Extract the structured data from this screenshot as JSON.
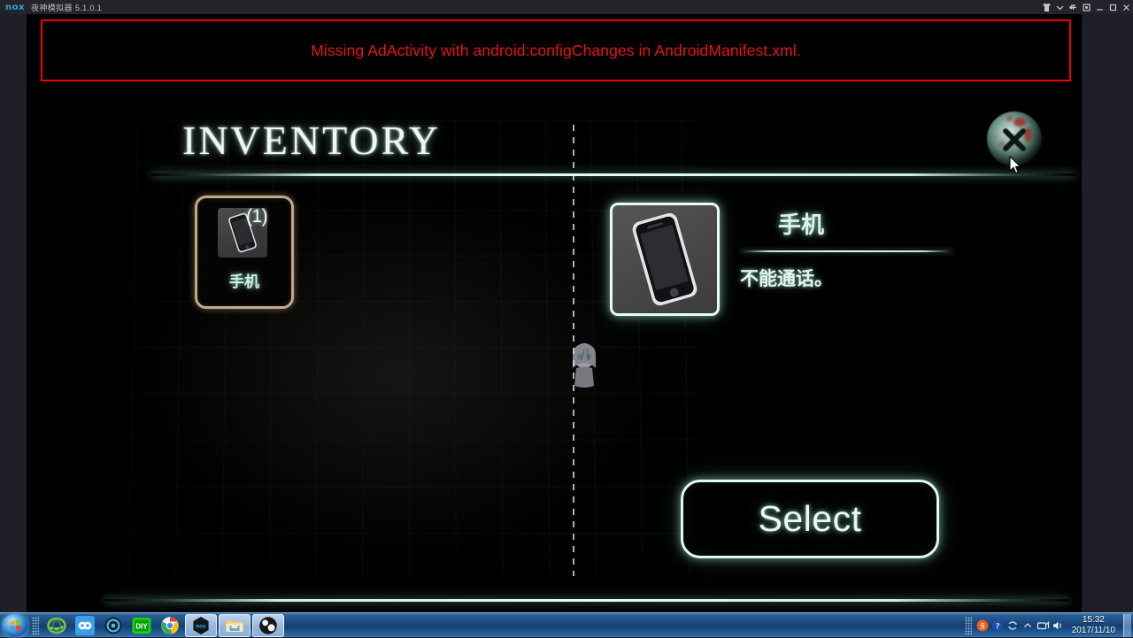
{
  "window": {
    "logo": "nox",
    "title": "夜神模拟器 5.1.0.1",
    "controls": [
      {
        "name": "shirt-icon",
        "label": "T"
      },
      {
        "name": "chevron-down-icon",
        "label": "v"
      },
      {
        "name": "pin-icon",
        "label": "P"
      },
      {
        "name": "gear-icon",
        "label": "G"
      },
      {
        "name": "minimize-button",
        "label": "—"
      },
      {
        "name": "maximize-button",
        "label": "❐"
      },
      {
        "name": "close-button",
        "label": "✕"
      }
    ]
  },
  "ad_error": {
    "message": "Missing AdActivity with android:configChanges in AndroidManifest.xml.",
    "border_color": "#ee0000",
    "text_color": "#e61616"
  },
  "game": {
    "title": "INVENTORY",
    "close_button_label": "X",
    "accent_color": "#dffaf1",
    "slot_border_color": "#c3a887",
    "slots": [
      {
        "label": "手机",
        "count": "(1)",
        "icon": "phone-icon"
      }
    ],
    "detail": {
      "name": "手机",
      "description": "不能通话。",
      "icon": "phone-icon"
    },
    "select_button": "Select"
  },
  "taskbar": {
    "start": "start-orb",
    "items": [
      {
        "name": "taskbar-icon-internet-explorer",
        "label": "e"
      },
      {
        "name": "taskbar-icon-baidu-cloud",
        "label": "cloud"
      },
      {
        "name": "taskbar-icon-media-player",
        "label": "circle"
      },
      {
        "name": "taskbar-icon-diy",
        "label": "DIY"
      },
      {
        "name": "taskbar-icon-chrome",
        "label": "chrome"
      }
    ],
    "buttons": [
      {
        "name": "taskbar-button-nox",
        "label": "nox"
      },
      {
        "name": "taskbar-button-explorer",
        "label": "folder"
      },
      {
        "name": "taskbar-button-obs",
        "label": "obs"
      }
    ],
    "tray": [
      {
        "name": "tray-icon-sogou-input",
        "label": "S"
      },
      {
        "name": "tray-icon-help",
        "label": "?"
      },
      {
        "name": "tray-icon-sync",
        "label": "sync"
      },
      {
        "name": "tray-icon-show-hidden",
        "label": "▲"
      },
      {
        "name": "tray-icon-network",
        "label": "net"
      },
      {
        "name": "tray-icon-volume",
        "label": "vol"
      }
    ],
    "clock_time": "15:32",
    "clock_date": "2017/11/10"
  }
}
